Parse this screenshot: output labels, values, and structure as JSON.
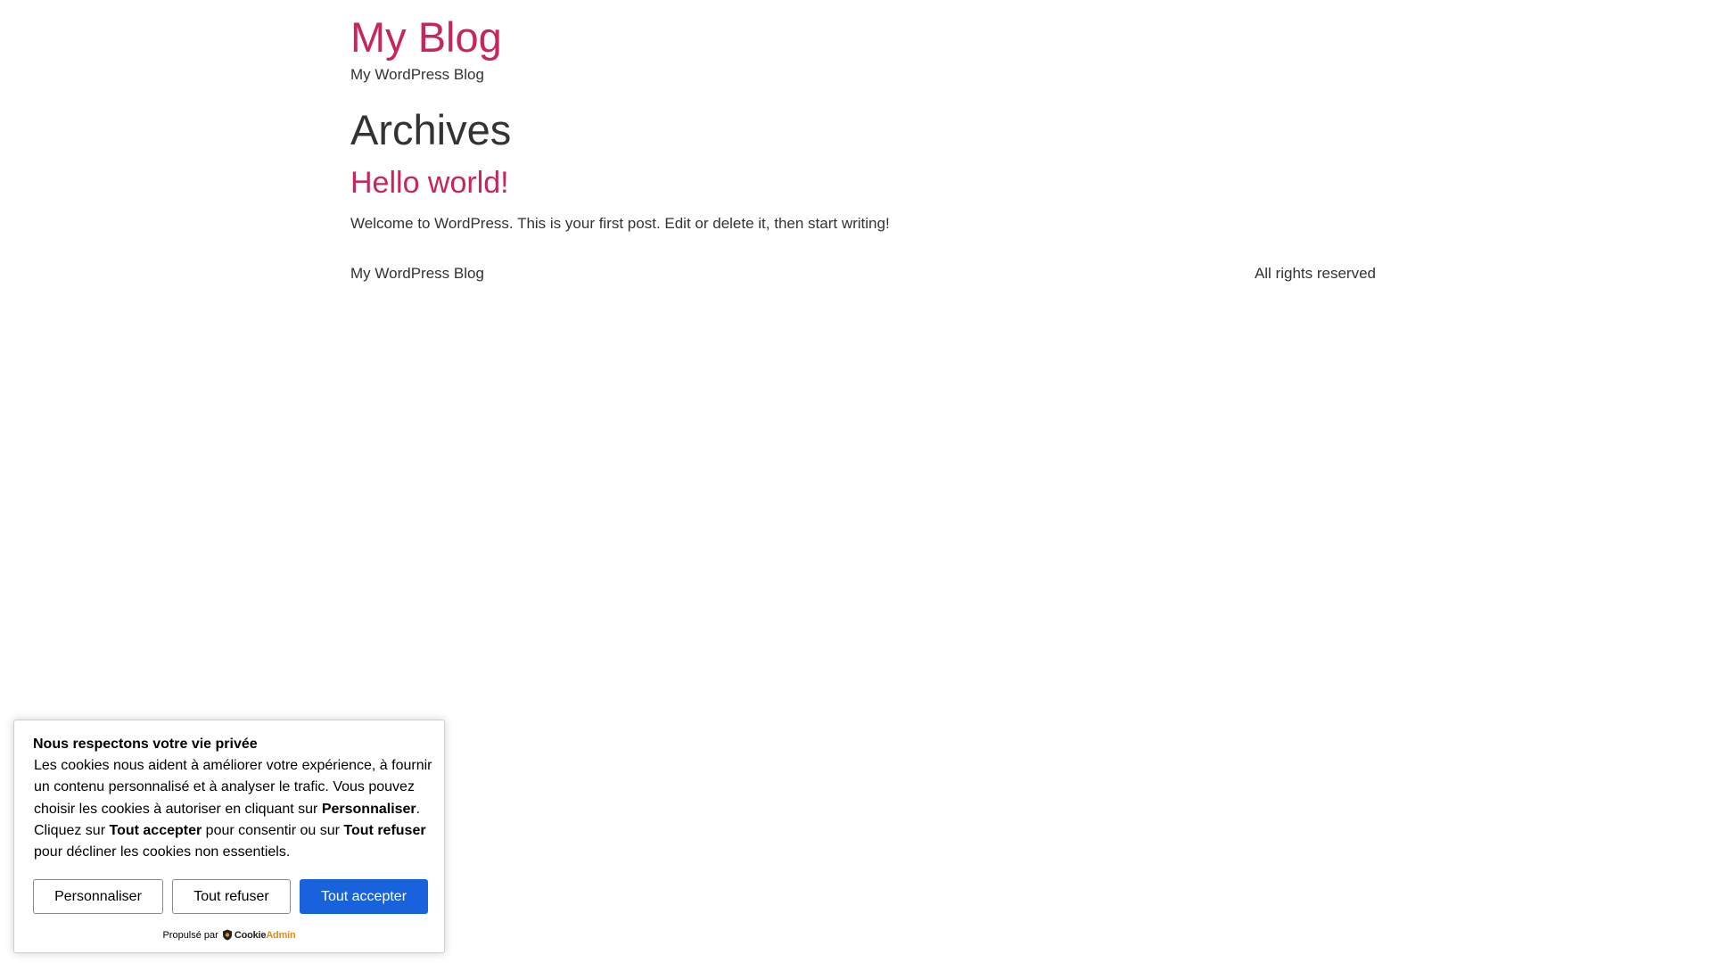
{
  "site": {
    "title": "My Blog",
    "tagline": "My WordPress Blog"
  },
  "archive": {
    "heading": "Archives",
    "posts": [
      {
        "title": "Hello world!",
        "excerpt": "Welcome to WordPress. This is your first post. Edit or delete it, then start writing!"
      }
    ]
  },
  "footer": {
    "left": "My WordPress Blog",
    "right": "All rights reserved"
  },
  "cookie_consent": {
    "title": "Nous respectons votre vie privée",
    "text_part1": "Les cookies nous aident à améliorer votre expérience, à fournir un contenu personnalisé et à analyser le trafic. Vous pouvez choisir les cookies à autoriser en cliquant sur ",
    "text_bold1": "Personnaliser",
    "text_part2": ". Cliquez sur ",
    "text_bold2": "Tout accepter",
    "text_part3": " pour consentir ou sur ",
    "text_bold3": "Tout refuser",
    "text_part4": " pour décliner les cookies non essentiels.",
    "buttons": {
      "customize": "Personnaliser",
      "reject": "Tout refuser",
      "accept": "Tout accepter"
    },
    "powered_by": "Propulsé par",
    "brand_part1": "Cookie",
    "brand_part2": "Admin"
  },
  "colors": {
    "link": "#c7255e",
    "text": "#333333",
    "accept_button": "#1863dc",
    "brand_accent": "#e58a14"
  }
}
